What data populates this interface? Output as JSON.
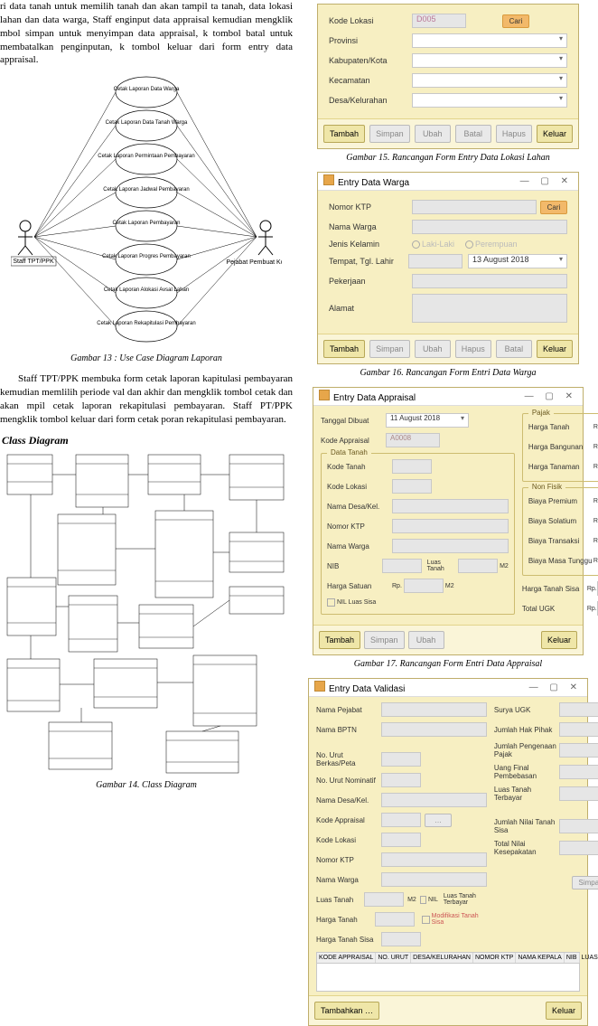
{
  "left": {
    "para_top": "ri data tanah untuk memilih tanah dan akan tampil ta tanah, data lokasi lahan dan data warga, Staff enginput data appraisal kemudian mengklik mbol simpan untuk menyimpan data appraisal, k tombol batal untuk membatalkan penginputan, k tombol keluar dari form entry data appraisal.",
    "usecase": {
      "actor_left": "Staff TPT/PPK",
      "actor_right": "Pejabat Pembuat Komitmen",
      "cases": [
        "Cetak Laporan Data Warga",
        "Cetak Laporan Data Tanah Warga",
        "Cetak Laporan Permintaan Pembayaran",
        "Cetak Laporan Jadwal Pembayaran",
        "Cetak Laporan Pembayaran",
        "Cetak Laporan Progres Pembayaran",
        "Cetak Laporan Alokasi Avsal Lahan",
        "Cetak Laporan Rekapitulasi Pembayaran"
      ]
    },
    "caption13": "Gambar 13 : Use Case Diagram Laporan",
    "para_mid": "Staff TPT/PPK membuka form cetak laporan kapitulasi pembayaran kemudian memlilih periode val dan akhir dan mengklik tombol cetak dan akan mpil cetak laporan rekapitulasi pembayaran. Staff PT/PPK mengklik tombol keluar dari form cetak poran rekapitulasi pembayaran.",
    "class_heading": "Class Diagram",
    "caption14": "Gambar 14. Class Diagram"
  },
  "form15": {
    "labels": {
      "kode_lokasi": "Kode Lokasi",
      "provinsi": "Provinsi",
      "kabupaten": "Kabupaten/Kota",
      "kecamatan": "Kecamatan",
      "desa": "Desa/Kelurahan"
    },
    "values": {
      "kode_lokasi": "D005"
    },
    "btn_cari": "Cari",
    "buttons": [
      "Tambah",
      "Simpan",
      "Ubah",
      "Batal",
      "Hapus",
      "Keluar"
    ],
    "caption": "Gambar 15. Rancangan Form Entry Data Lokasi Lahan"
  },
  "form16": {
    "title": "Entry Data Warga",
    "labels": {
      "ktp": "Nomor KTP",
      "nama": "Nama Warga",
      "jk": "Jenis Kelamin",
      "ttl": "Tempat, Tgl. Lahir",
      "pekerjaan": "Pekerjaan",
      "alamat": "Alamat",
      "laki": "Laki-Laki",
      "perempuan": "Perempuan"
    },
    "date": "13   August   2018",
    "btn_cari": "Cari",
    "buttons": [
      "Tambah",
      "Simpan",
      "Ubah",
      "Hapus",
      "Batal",
      "Keluar"
    ],
    "caption": "Gambar 16. Rancangan Form Entri Data Warga"
  },
  "form17": {
    "title": "Entry Data Appraisal",
    "left_labels": {
      "tgl": "Tanggal Dibuat",
      "kode_app": "Kode Appraisal"
    },
    "date": "11   August   2018",
    "kode_value": "A0008",
    "group_tanah": "Data Tanah",
    "tanah_labels": {
      "kode_tanah": "Kode Tanah",
      "kode_lokasi": "Kode Lokasi",
      "nama_desa": "Nama Desa/Kel.",
      "ktp": "Nomor KTP",
      "nama": "Nama Warga",
      "nib": "NIB",
      "luas_tanah_in": "Luas Tanah",
      "harga_sat": "Harga Satuan",
      "nil_luas": "NIL   Luas Sisa"
    },
    "units": {
      "m2": "M2",
      "rp": "Rp."
    },
    "group_pajak": "Pajak",
    "right_labels": {
      "harga_tanah": "Harga Tanah",
      "harga_bang": "Harga Bangunan",
      "harga_tan": "Harga Tanaman"
    },
    "group_non": "Non Fisik",
    "non_labels": {
      "biaya_prem": "Biaya Premium",
      "biaya_solat": "Biaya Solatium",
      "biaya_trans": "Biaya Transaksi",
      "biaya_tunggu": "Biaya Masa Tunggu"
    },
    "tot_labels": {
      "harga_sisa": "Harga Tanah Sisa",
      "total_ugk": "Total UGK"
    },
    "buttons": [
      "Tambah",
      "Simpan",
      "Ubah"
    ],
    "btn_keluar": "Keluar",
    "caption": "Gambar 17. Rancangan Form Entri Data Appraisal"
  },
  "form18": {
    "title": "Entry Data Validasi",
    "left_labels": [
      "Nama Pejabat",
      "Nama BPTN",
      "",
      "No. Urut Berkas/Peta",
      "No. Urut Nominatif",
      "Nama Desa/Kel.",
      "Kode Appraisal",
      "Kode Lokasi",
      "Nomor KTP",
      "Nama Warga",
      "Luas Tanah",
      "Harga Tanah",
      "Harga Tanah Sisa"
    ],
    "right_labels": [
      "Surya UGK",
      "Jumlah Hak Pihak",
      "Jumlah Pengenaan Pajak",
      "Uang Final Pembebasan",
      "Luas Tanah Terbayar",
      "",
      "Jumlah Nilai Tanah Sisa",
      "Total Nilai Kesepakatan"
    ],
    "unit_m2": "M2",
    "unit_nil": "NIL",
    "lbl_luas_terb": "Luas Tanah Terbayar",
    "lbl_mod": "Modifikasi Tanah Sisa",
    "lbl_simpan": "Simpan",
    "grid_cols": [
      "KODE APPRAISAL",
      "NO. URUT",
      "DESA/KELURAHAN",
      "NOMOR KTP",
      "NAMA KEPALA",
      "NIB",
      "LUAS TANAH GANT"
    ],
    "tambah": "Tambahkan …",
    "keluar": "Keluar"
  }
}
